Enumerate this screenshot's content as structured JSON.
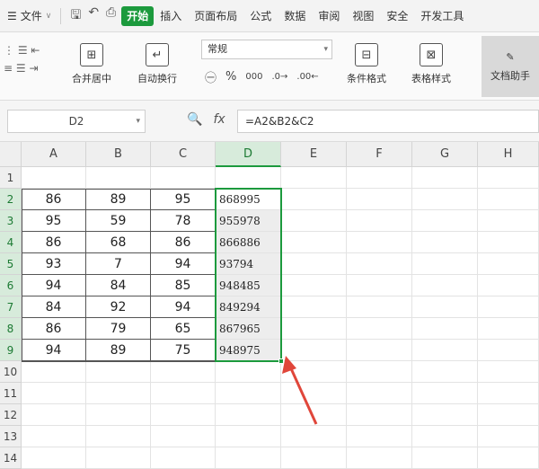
{
  "menubar": {
    "file_label": "文件",
    "tabs": [
      "开始",
      "插入",
      "页面布局",
      "公式",
      "数据",
      "审阅",
      "视图",
      "安全",
      "开发工具"
    ],
    "active_tab": "开始"
  },
  "ribbon": {
    "merge_label": "合并居中",
    "wrap_label": "自动换行",
    "number_format": "常规",
    "cond_format_label": "条件格式",
    "table_style_label": "表格样式",
    "doc_assistant_label": "文档助手",
    "percent_symbol": "%"
  },
  "formula_bar": {
    "name_box": "D2",
    "fx_label": "fx",
    "formula": "=A2&B2&C2"
  },
  "sheet": {
    "columns": [
      "A",
      "B",
      "C",
      "D",
      "E",
      "F",
      "G",
      "H"
    ],
    "rows": [
      "1",
      "2",
      "3",
      "4",
      "5",
      "6",
      "7",
      "8",
      "9",
      "10",
      "11",
      "12",
      "13",
      "14"
    ],
    "data": [
      [
        "86",
        "89",
        "95",
        "868995"
      ],
      [
        "95",
        "59",
        "78",
        "955978"
      ],
      [
        "86",
        "68",
        "86",
        "866886"
      ],
      [
        "93",
        "7",
        "94",
        "93794"
      ],
      [
        "94",
        "84",
        "85",
        "948485"
      ],
      [
        "84",
        "92",
        "94",
        "849294"
      ],
      [
        "86",
        "79",
        "65",
        "867965"
      ],
      [
        "94",
        "89",
        "75",
        "948975"
      ]
    ],
    "selected_column": "D",
    "selection": "D2:D9",
    "accent_color": "#1c9a3d",
    "arrow_color": "#e0463a"
  }
}
